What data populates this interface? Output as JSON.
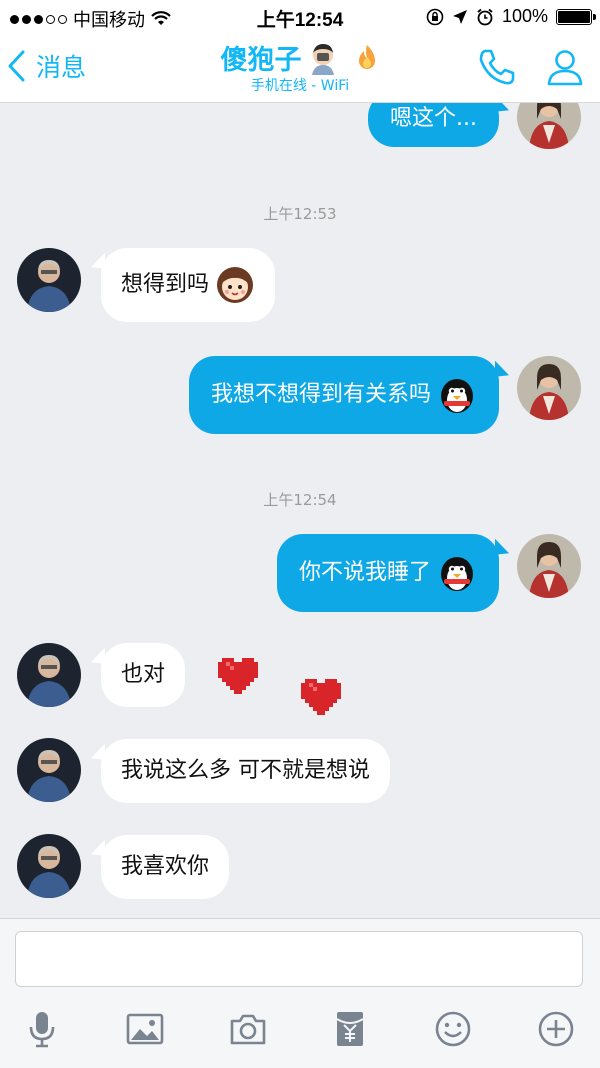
{
  "status_bar": {
    "carrier": "中国移动",
    "time": "上午12:54",
    "battery": "100%",
    "battery_level": 1.0,
    "signal_bars": 3,
    "icons": [
      "wifi-icon",
      "orientation-lock-icon",
      "location-icon",
      "alarm-icon",
      "battery-icon"
    ]
  },
  "nav": {
    "back_label": "消息",
    "title": "傻狍子",
    "subtitle": "手机在线 - WiFi",
    "icons": [
      "user-emoji-icon",
      "flame-icon",
      "phone-icon",
      "profile-icon"
    ]
  },
  "messages": {
    "m0": {
      "text": "嗯这个...",
      "side": "out"
    },
    "t1": "上午12:53",
    "m1": {
      "text": "想得到吗",
      "side": "in",
      "emoji": "girl-face-emoji-icon"
    },
    "m2": {
      "text": "我想不想得到有关系吗",
      "side": "out",
      "emoji": "penguin-emoji-icon"
    },
    "t2": "上午12:54",
    "m3": {
      "text": "你不说我睡了",
      "side": "out",
      "emoji": "penguin-emoji-icon"
    },
    "m4": {
      "text": "也对",
      "side": "in",
      "stickers": [
        "pixel-heart-icon",
        "pixel-heart-icon"
      ]
    },
    "m5": {
      "text": "我说这么多 可不就是想说",
      "side": "in"
    },
    "m6": {
      "text": "我喜欢你",
      "side": "in"
    }
  },
  "input": {
    "placeholder": ""
  },
  "toolbar": [
    "microphone-icon",
    "image-icon",
    "camera-icon",
    "red-packet-icon",
    "smiley-icon",
    "plus-icon"
  ],
  "colors": {
    "accent": "#12b7f5",
    "outgoing_bubble": "#0ea8e6",
    "background": "#eceef1"
  }
}
